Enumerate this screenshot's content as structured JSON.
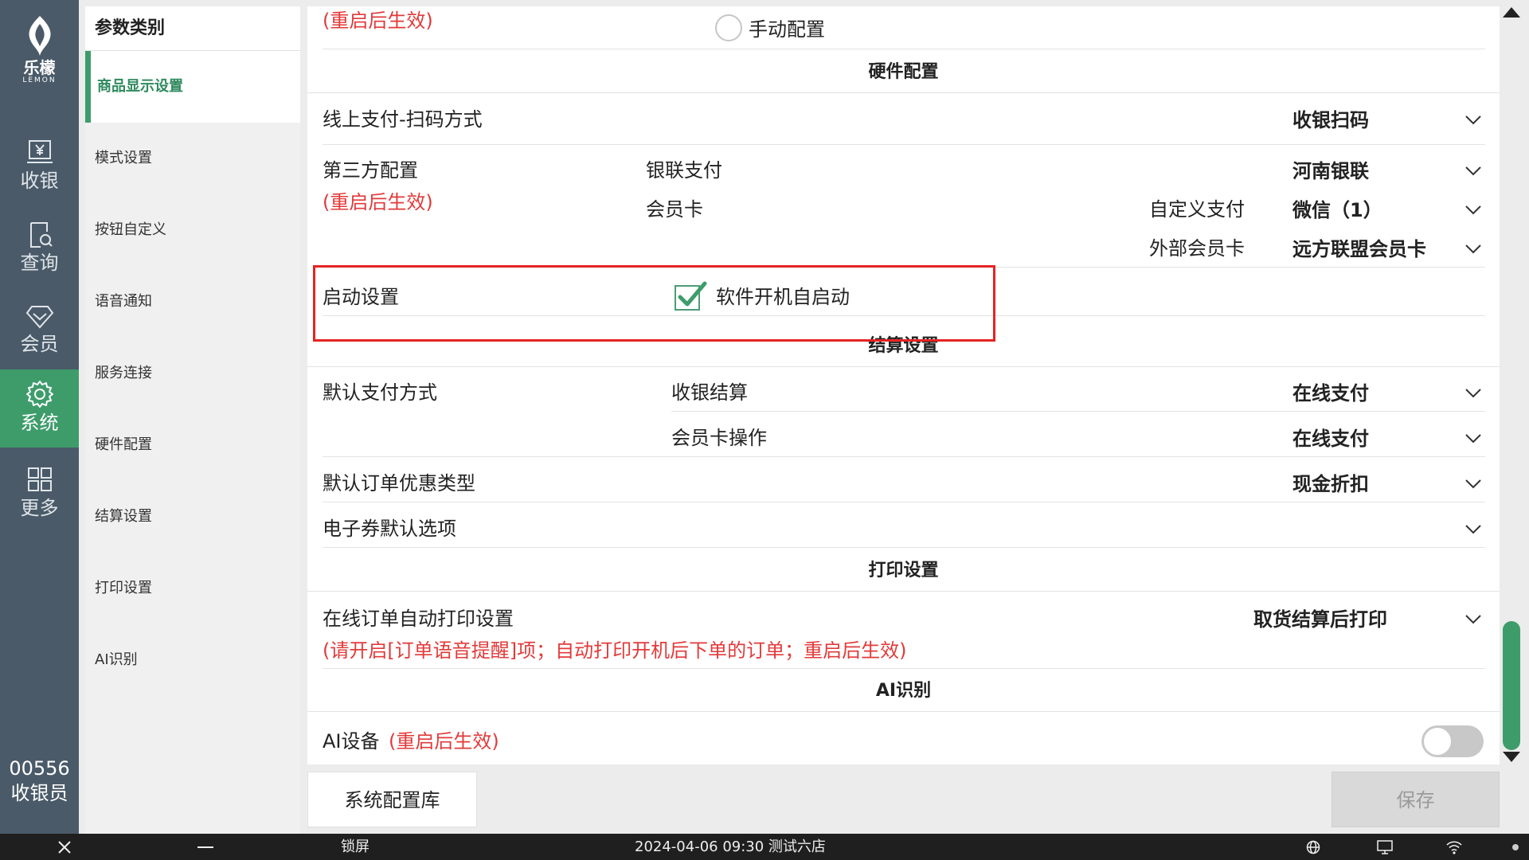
{
  "app": {
    "logo_cn": "乐檬",
    "logo_en": "LEMON"
  },
  "nav": {
    "items": [
      {
        "label": "收银",
        "icon": "cashier-icon"
      },
      {
        "label": "查询",
        "icon": "search-doc-icon"
      },
      {
        "label": "会员",
        "icon": "diamond-icon"
      },
      {
        "label": "系统",
        "icon": "gear-icon",
        "active": true
      },
      {
        "label": "更多",
        "icon": "grid-icon"
      }
    ],
    "user_id": "00556",
    "user_role": "收银员"
  },
  "categories": {
    "header": "参数类别",
    "items": [
      {
        "label": "商品显示设置",
        "active": true
      },
      {
        "label": "模式设置"
      },
      {
        "label": "按钮自定义"
      },
      {
        "label": "语音通知"
      },
      {
        "label": "服务连接"
      },
      {
        "label": "硬件配置"
      },
      {
        "label": "结算设置"
      },
      {
        "label": "打印设置"
      },
      {
        "label": "AI识别"
      }
    ]
  },
  "main": {
    "top_note": "(重启后生效)",
    "manual_config_label": "手动配置",
    "hardware": {
      "title": "硬件配置",
      "online_pay_label": "线上支付-扫码方式",
      "online_pay_value": "收银扫码",
      "third_party_label": "第三方配置",
      "third_party_note": "(重启后生效)",
      "unionpay_label": "银联支付",
      "unionpay_value": "河南银联",
      "member_card_label": "会员卡",
      "custom_pay_label": "自定义支付",
      "custom_pay_value": "微信（1）",
      "external_card_label": "外部会员卡",
      "external_card_value": "远方联盟会员卡",
      "startup_label": "启动设置",
      "autostart_label": "软件开机自启动",
      "autostart_checked": true
    },
    "settlement": {
      "title": "结算设置",
      "default_pay_label": "默认支付方式",
      "cashier_settle_label": "收银结算",
      "cashier_settle_value": "在线支付",
      "card_op_label": "会员卡操作",
      "card_op_value": "在线支付",
      "discount_label": "默认订单优惠类型",
      "discount_value": "现金折扣",
      "coupon_label": "电子券默认选项",
      "coupon_value": ""
    },
    "print": {
      "title": "打印设置",
      "auto_print_label": "在线订单自动打印设置",
      "auto_print_value": "取货结算后打印",
      "auto_print_note": "(请开启[订单语音提醒]项；自动打印开机后下单的订单；重启后生效)"
    },
    "ai": {
      "title": "AI识别",
      "device_label": "AI设备",
      "device_note": "(重启后生效)",
      "device_enabled": false
    }
  },
  "footer": {
    "config_lib_button": "系统配置库",
    "save_button": "保存"
  },
  "taskbar": {
    "lock_label": "锁屏",
    "datetime_store": "2024-04-06 09:30 测试六店"
  },
  "colors": {
    "nav_bg": "#4a5a68",
    "accent_green": "#3e9c6b",
    "warning_red": "#e23a3a",
    "highlight_box": "#e62323"
  }
}
